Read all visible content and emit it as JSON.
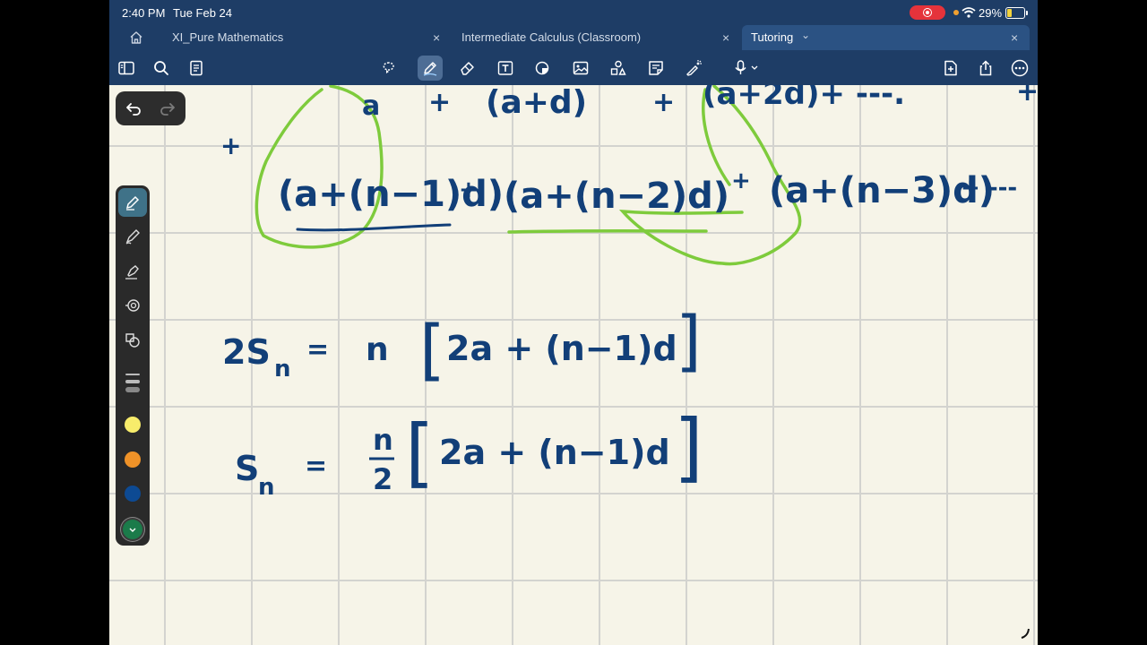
{
  "status": {
    "time": "2:40 PM",
    "date": "Tue Feb 24",
    "battery": "29%",
    "battery_level": 0.29,
    "colors": {
      "record": "#e5333b",
      "battery_fill": "#f2d23c"
    }
  },
  "tabs": [
    {
      "label": "XI_Pure Mathematics",
      "close": "×"
    },
    {
      "label": "Intermediate Calculus (Classroom)",
      "close": "×"
    },
    {
      "label": "Tutoring",
      "caret": "⌄",
      "close": "×",
      "active": true
    }
  ],
  "toolbar": {
    "left": [
      "sidebar-icon",
      "search-icon",
      "thumbnails-icon"
    ],
    "center": [
      "lasso-icon",
      "pen-icon",
      "eraser-icon",
      "text-icon",
      "shapes-icon",
      "image-icon",
      "elements-icon",
      "sticky-note-icon",
      "laser-pointer-icon",
      "microphone-icon"
    ],
    "right": [
      "add-page-icon",
      "share-icon",
      "more-icon"
    ]
  },
  "colors": {
    "topbar": "#1e3d66",
    "active_tab": "#2b5283",
    "paper": "#f6f4e8",
    "grid": "#d3d3cf",
    "ink": "#123f78",
    "highlight": "#7ecb3c"
  },
  "palette": {
    "tools": [
      "fountain-pen-icon",
      "brush-pen-icon",
      "highlighter-icon",
      "tape-icon",
      "shape-tool-icon"
    ],
    "swatches": [
      "#f7ec6b",
      "#ef9228",
      "#0d4a93",
      "#1b7b4a"
    ]
  },
  "notes": {
    "line1": {
      "t1": "a",
      "t2": "+",
      "t3": "(a+d)",
      "t4": "+",
      "t5": "(a+2d)+ ---.",
      "t6": "+"
    },
    "line2": {
      "lead": "+",
      "t1": "(a+(n−1)d)",
      "t2": "+",
      "t3": "(a+(n−2)d)",
      "t4": "+",
      "t5": "(a+(n−3)d)",
      "t6": "+ ---"
    },
    "eq1": {
      "lhs": "2S",
      "sub": "n",
      "eq": "=",
      "coef": "n",
      "lb": "[",
      "body": "2a + (n−1)d",
      "rb": "]"
    },
    "eq2": {
      "lhs": "S",
      "sub": "n",
      "eq": "=",
      "num": "n",
      "den": "2",
      "lb": "[",
      "body": "2a + (n−1)d",
      "rb": "]"
    }
  }
}
